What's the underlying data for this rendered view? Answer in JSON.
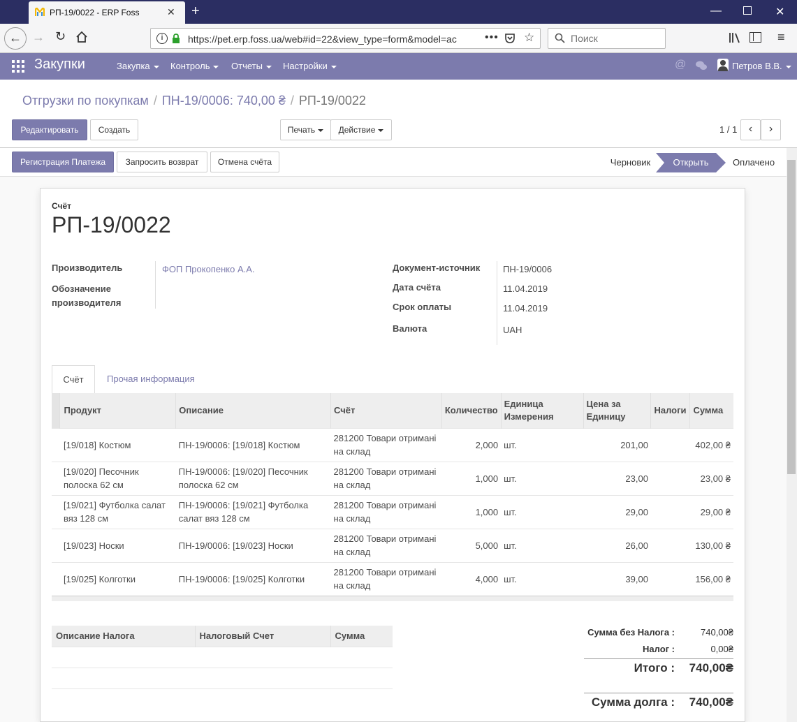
{
  "browser": {
    "tab_title": "РП-19/0022 - ERP Foss",
    "url": "https://pet.erp.foss.ua/web#id=22&view_type=form&model=ac",
    "search_placeholder": "Поиск"
  },
  "app": {
    "title": "Закупки",
    "menu": [
      "Закупка",
      "Контроль",
      "Отчеты",
      "Настройки"
    ],
    "user": "Петров В.В."
  },
  "breadcrumb": {
    "items": [
      "Отгрузки по покупкам",
      "ПН-19/0006: 740,00 ₴",
      "РП-19/0022"
    ]
  },
  "buttons": {
    "edit": "Редактировать",
    "create": "Создать",
    "print": "Печать",
    "action": "Действие",
    "pager": "1 / 1",
    "register_payment": "Регистрация Платежа",
    "request_refund": "Запросить возврат",
    "cancel_invoice": "Отмена счёта"
  },
  "stages": {
    "draft": "Черновик",
    "open": "Открыть",
    "paid": "Оплачено"
  },
  "invoice": {
    "type_label": "Счёт",
    "number": "РП-19/0022",
    "vendor_label": "Производитель",
    "vendor": "ФОП Прокопенко А.А.",
    "vendor_ref_label": "Обозначение производителя",
    "source_label": "Документ-источник",
    "source": "ПН-19/0006",
    "date_label": "Дата счёта",
    "date": "11.04.2019",
    "due_label": "Срок оплаты",
    "due": "11.04.2019",
    "currency_label": "Валюта",
    "currency": "UAH"
  },
  "tabs": {
    "invoice": "Счёт",
    "other": "Прочая информация"
  },
  "lines": {
    "headers": {
      "product": "Продукт",
      "description": "Описание",
      "account": "Счёт",
      "qty": "Количество",
      "uom": "Единица Измерения",
      "price": "Цена за Единицу",
      "taxes": "Налоги",
      "amount": "Сумма"
    },
    "rows": [
      {
        "product": "[19/018] Костюм",
        "description": "ПН-19/0006: [19/018] Костюм",
        "account": "281200 Товари отримані на склад",
        "qty": "2,000",
        "uom": "шт.",
        "price": "201,00",
        "taxes": "",
        "amount": "402,00 ₴"
      },
      {
        "product": "[19/020] Песочник полоска 62 см",
        "description": "ПН-19/0006: [19/020] Песочник полоска 62 см",
        "account": "281200 Товари отримані на склад",
        "qty": "1,000",
        "uom": "шт.",
        "price": "23,00",
        "taxes": "",
        "amount": "23,00 ₴"
      },
      {
        "product": "[19/021] Футболка салат вяз 128 см",
        "description": "ПН-19/0006: [19/021] Футболка салат вяз 128 см",
        "account": "281200 Товари отримані на склад",
        "qty": "1,000",
        "uom": "шт.",
        "price": "29,00",
        "taxes": "",
        "amount": "29,00 ₴"
      },
      {
        "product": "[19/023] Носки",
        "description": "ПН-19/0006: [19/023] Носки",
        "account": "281200 Товари отримані на склад",
        "qty": "5,000",
        "uom": "шт.",
        "price": "26,00",
        "taxes": "",
        "amount": "130,00 ₴"
      },
      {
        "product": "[19/025] Колготки",
        "description": "ПН-19/0006: [19/025] Колготки",
        "account": "281200 Товари отримані на склад",
        "qty": "4,000",
        "uom": "шт.",
        "price": "39,00",
        "taxes": "",
        "amount": "156,00 ₴"
      }
    ]
  },
  "tax_table": {
    "headers": {
      "description": "Описание Налога",
      "account": "Налоговый Счет",
      "amount": "Сумма"
    }
  },
  "totals": {
    "untaxed_label": "Сумма без Налога :",
    "untaxed": "740,00₴",
    "tax_label": "Налог :",
    "tax": "0,00₴",
    "total_label": "Итого :",
    "total": "740,00₴",
    "due_label": "Сумма долга :",
    "due": "740,00₴"
  },
  "colors": {
    "brand": "#7c7bad",
    "titlebar": "#2b2e62"
  }
}
